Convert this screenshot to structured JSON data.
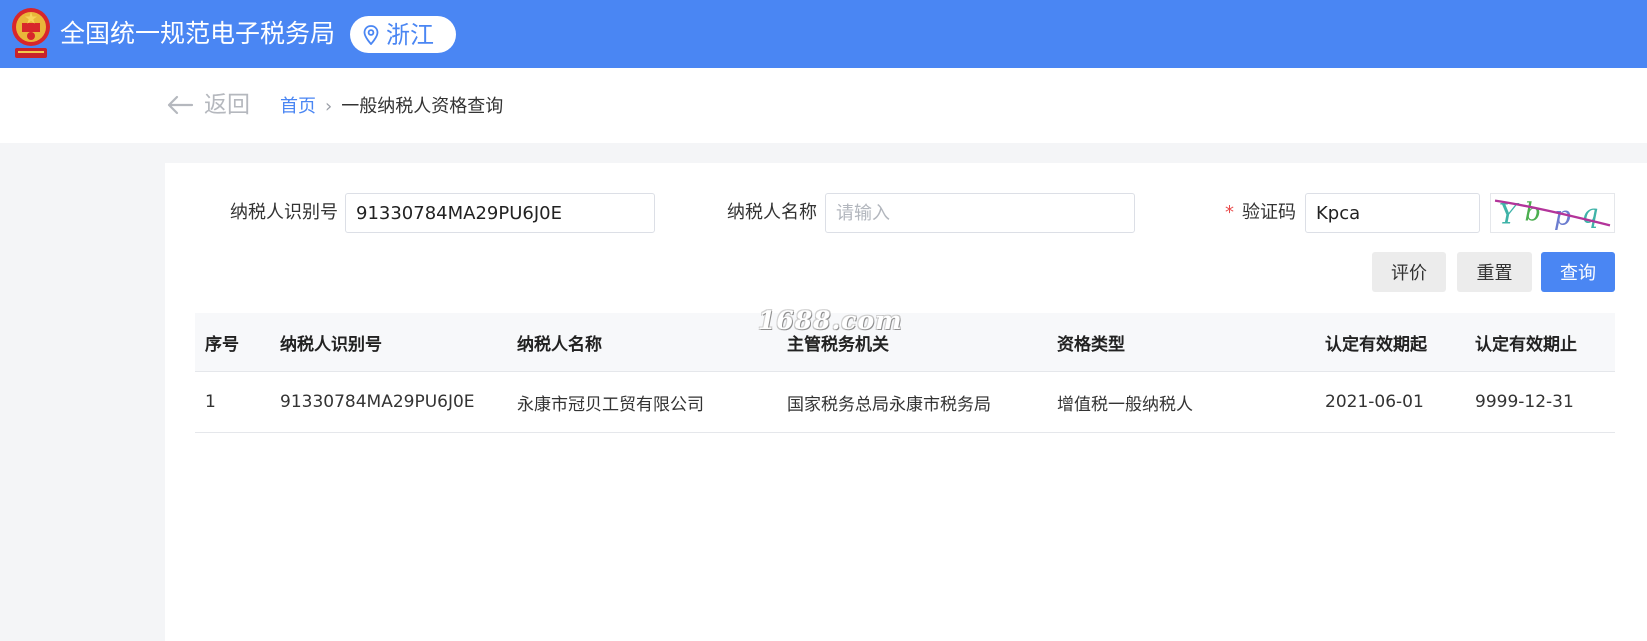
{
  "header": {
    "title": "全国统一规范电子税务局",
    "region": "浙江",
    "colors": {
      "bar": "#4a86f3",
      "accent": "#4a86f3"
    },
    "icons": {
      "emblem": "national-emblem-icon",
      "location": "location-pin-icon"
    }
  },
  "nav": {
    "back_label": "返回",
    "breadcrumb": {
      "home": "首页",
      "separator": "›",
      "current": "一般纳税人资格查询"
    }
  },
  "form": {
    "taxpayer_id": {
      "label": "纳税人识别号",
      "value": "91330784MA29PU6J0E"
    },
    "taxpayer_name": {
      "label": "纳税人名称",
      "value": "",
      "placeholder": "请输入"
    },
    "captcha": {
      "required_mark": "*",
      "label": "验证码",
      "value": "Kpca",
      "image_text": "Ybpq"
    }
  },
  "buttons": {
    "evaluate": "评价",
    "reset": "重置",
    "query": "查询"
  },
  "table": {
    "columns": [
      "序号",
      "纳税人识别号",
      "纳税人名称",
      "主管税务机关",
      "资格类型",
      "认定有效期起",
      "认定有效期止"
    ],
    "rows": [
      [
        "1",
        "91330784MA29PU6J0E",
        "永康市冠贝工贸有限公司",
        "国家税务总局永康市税务局",
        "增值税一般纳税人",
        "2021-06-01",
        "9999-12-31"
      ]
    ]
  },
  "watermark": "1688.com"
}
